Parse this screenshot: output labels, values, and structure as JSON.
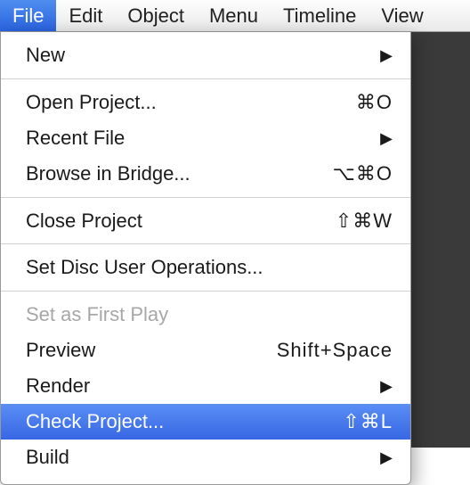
{
  "menubar": {
    "items": [
      {
        "label": "File",
        "active": true
      },
      {
        "label": "Edit",
        "active": false
      },
      {
        "label": "Object",
        "active": false
      },
      {
        "label": "Menu",
        "active": false
      },
      {
        "label": "Timeline",
        "active": false
      },
      {
        "label": "View",
        "active": false
      }
    ]
  },
  "file_menu": {
    "items": [
      {
        "label": "New",
        "submenu": true,
        "shortcut": "",
        "disabled": false,
        "highlight": false
      },
      {
        "separator": true
      },
      {
        "label": "Open Project...",
        "submenu": false,
        "shortcut": "⌘O",
        "disabled": false,
        "highlight": false
      },
      {
        "label": "Recent File",
        "submenu": true,
        "shortcut": "",
        "disabled": false,
        "highlight": false
      },
      {
        "label": "Browse in Bridge...",
        "submenu": false,
        "shortcut": "⌥⌘O",
        "disabled": false,
        "highlight": false
      },
      {
        "separator": true
      },
      {
        "label": "Close Project",
        "submenu": false,
        "shortcut": "⇧⌘W",
        "disabled": false,
        "highlight": false
      },
      {
        "separator": true
      },
      {
        "label": "Set Disc User Operations...",
        "submenu": false,
        "shortcut": "",
        "disabled": false,
        "highlight": false
      },
      {
        "separator": true
      },
      {
        "label": "Set as First Play",
        "submenu": false,
        "shortcut": "",
        "disabled": true,
        "highlight": false
      },
      {
        "label": "Preview",
        "submenu": false,
        "shortcut": "Shift+Space",
        "disabled": false,
        "highlight": false
      },
      {
        "label": "Render",
        "submenu": true,
        "shortcut": "",
        "disabled": false,
        "highlight": false
      },
      {
        "label": "Check Project...",
        "submenu": false,
        "shortcut": "⇧⌘L",
        "disabled": false,
        "highlight": true
      },
      {
        "label": "Build",
        "submenu": true,
        "shortcut": "",
        "disabled": false,
        "highlight": false
      }
    ]
  },
  "glyphs": {
    "submenu_arrow": "▶"
  }
}
